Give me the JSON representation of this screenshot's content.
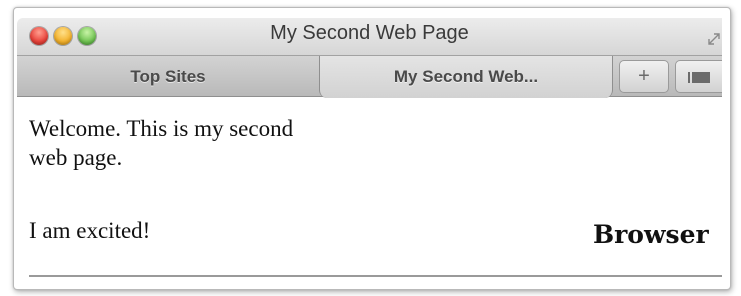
{
  "window": {
    "title": "My Second Web Page"
  },
  "tabs": [
    {
      "label": "Top Sites",
      "active": false
    },
    {
      "label": "My Second Web...",
      "active": true
    }
  ],
  "tab_buttons": {
    "new_tab_glyph": "+",
    "tab_list_icon": "tab-list-icon"
  },
  "content": {
    "paragraph1": "Welcome. This is my second web page.",
    "paragraph2": "I am excited!"
  },
  "caption": "Browser"
}
